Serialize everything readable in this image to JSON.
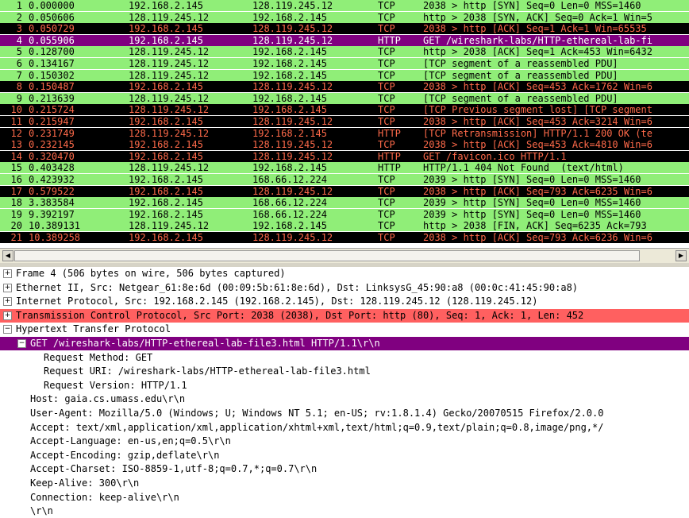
{
  "colors": {
    "tcp_ok_bg": "#90ee78",
    "tcp_bad_bg": "#000000",
    "tcp_bad_fg": "#ff6a4a",
    "selected_bg": "#800080",
    "selected_fg": "#ffffff",
    "tcp_tree_bg": "#ff6060",
    "http_tree_bg": "#800080"
  },
  "packets": [
    {
      "no": "1",
      "time": "0.000000",
      "src": "192.168.2.145",
      "dst": "128.119.245.12",
      "proto": "TCP",
      "info": "2038 > http [SYN] Seq=0 Len=0 MSS=1460",
      "style": "ok"
    },
    {
      "no": "2",
      "time": "0.050606",
      "src": "128.119.245.12",
      "dst": "192.168.2.145",
      "proto": "TCP",
      "info": "http > 2038 [SYN, ACK] Seq=0 Ack=1 Win=5",
      "style": "ok"
    },
    {
      "no": "3",
      "time": "0.050729",
      "src": "192.168.2.145",
      "dst": "128.119.245.12",
      "proto": "TCP",
      "info": "2038 > http [ACK] Seq=1 Ack=1 Win=65535",
      "style": "bad"
    },
    {
      "no": "4",
      "time": "0.055906",
      "src": "192.168.2.145",
      "dst": "128.119.245.12",
      "proto": "HTTP",
      "info": "GET /wireshark-labs/HTTP-ethereal-lab-fi",
      "style": "selected"
    },
    {
      "no": "5",
      "time": "0.128700",
      "src": "128.119.245.12",
      "dst": "192.168.2.145",
      "proto": "TCP",
      "info": "http > 2038 [ACK] Seq=1 Ack=453 Win=6432",
      "style": "ok"
    },
    {
      "no": "6",
      "time": "0.134167",
      "src": "128.119.245.12",
      "dst": "192.168.2.145",
      "proto": "TCP",
      "info": "[TCP segment of a reassembled PDU]",
      "style": "ok"
    },
    {
      "no": "7",
      "time": "0.150302",
      "src": "128.119.245.12",
      "dst": "192.168.2.145",
      "proto": "TCP",
      "info": "[TCP segment of a reassembled PDU]",
      "style": "ok"
    },
    {
      "no": "8",
      "time": "0.150487",
      "src": "192.168.2.145",
      "dst": "128.119.245.12",
      "proto": "TCP",
      "info": "2038 > http [ACK] Seq=453 Ack=1762 Win=6",
      "style": "bad"
    },
    {
      "no": "9",
      "time": "0.213639",
      "src": "128.119.245.12",
      "dst": "192.168.2.145",
      "proto": "TCP",
      "info": "[TCP segment of a reassembled PDU]",
      "style": "ok"
    },
    {
      "no": "10",
      "time": "0.215724",
      "src": "128.119.245.12",
      "dst": "192.168.2.145",
      "proto": "TCP",
      "info": "[TCP Previous segment lost] [TCP segment",
      "style": "bad"
    },
    {
      "no": "11",
      "time": "0.215947",
      "src": "192.168.2.145",
      "dst": "128.119.245.12",
      "proto": "TCP",
      "info": "2038 > http [ACK] Seq=453 Ack=3214 Win=6",
      "style": "bad"
    },
    {
      "no": "12",
      "time": "0.231749",
      "src": "128.119.245.12",
      "dst": "192.168.2.145",
      "proto": "HTTP",
      "info": "[TCP Retransmission] HTTP/1.1 200 OK (te",
      "style": "bad"
    },
    {
      "no": "13",
      "time": "0.232145",
      "src": "192.168.2.145",
      "dst": "128.119.245.12",
      "proto": "TCP",
      "info": "2038 > http [ACK] Seq=453 Ack=4810 Win=6",
      "style": "bad"
    },
    {
      "no": "14",
      "time": "0.320470",
      "src": "192.168.2.145",
      "dst": "128.119.245.12",
      "proto": "HTTP",
      "info": "GET /favicon.ico HTTP/1.1",
      "style": "bad"
    },
    {
      "no": "15",
      "time": "0.403428",
      "src": "128.119.245.12",
      "dst": "192.168.2.145",
      "proto": "HTTP",
      "info": "HTTP/1.1 404 Not Found  (text/html)",
      "style": "ok"
    },
    {
      "no": "16",
      "time": "0.423932",
      "src": "192.168.2.145",
      "dst": "168.66.12.224",
      "proto": "TCP",
      "info": "2039 > http [SYN] Seq=0 Len=0 MSS=1460",
      "style": "ok"
    },
    {
      "no": "17",
      "time": "0.579522",
      "src": "192.168.2.145",
      "dst": "128.119.245.12",
      "proto": "TCP",
      "info": "2038 > http [ACK] Seq=793 Ack=6235 Win=6",
      "style": "bad"
    },
    {
      "no": "18",
      "time": "3.383584",
      "src": "192.168.2.145",
      "dst": "168.66.12.224",
      "proto": "TCP",
      "info": "2039 > http [SYN] Seq=0 Len=0 MSS=1460",
      "style": "ok"
    },
    {
      "no": "19",
      "time": "9.392197",
      "src": "192.168.2.145",
      "dst": "168.66.12.224",
      "proto": "TCP",
      "info": "2039 > http [SYN] Seq=0 Len=0 MSS=1460",
      "style": "ok"
    },
    {
      "no": "20",
      "time": "10.389131",
      "src": "128.119.245.12",
      "dst": "192.168.2.145",
      "proto": "TCP",
      "info": "http > 2038 [FIN, ACK] Seq=6235 Ack=793 ",
      "style": "ok"
    },
    {
      "no": "21",
      "time": "10.389258",
      "src": "192.168.2.145",
      "dst": "128.119.245.12",
      "proto": "TCP",
      "info": "2038 > http [ACK] Seq=793 Ack=6236 Win=6",
      "style": "bad"
    }
  ],
  "scrollbar": {
    "left_arrow": "◀",
    "right_arrow": "▶"
  },
  "details": [
    {
      "toggle": "+",
      "indent": 0,
      "text": "Frame 4 (506 bytes on wire, 506 bytes captured)",
      "style": "normal"
    },
    {
      "toggle": "+",
      "indent": 0,
      "text": "Ethernet II, Src: Netgear_61:8e:6d (00:09:5b:61:8e:6d), Dst: LinksysG_45:90:a8 (00:0c:41:45:90:a8)",
      "style": "normal"
    },
    {
      "toggle": "+",
      "indent": 0,
      "text": "Internet Protocol, Src: 192.168.2.145 (192.168.2.145), Dst: 128.119.245.12 (128.119.245.12)",
      "style": "normal"
    },
    {
      "toggle": "+",
      "indent": 0,
      "text": "Transmission Control Protocol, Src Port: 2038 (2038), Dst Port: http (80), Seq: 1, Ack: 1, Len: 452",
      "style": "tcp"
    },
    {
      "toggle": "−",
      "indent": 0,
      "text": "Hypertext Transfer Protocol",
      "style": "normal"
    },
    {
      "toggle": "−",
      "indent": 1,
      "text": "GET /wireshark-labs/HTTP-ethereal-lab-file3.html HTTP/1.1\\r\\n",
      "style": "http"
    },
    {
      "toggle": "",
      "indent": 3,
      "text": "Request Method: GET",
      "style": "normal"
    },
    {
      "toggle": "",
      "indent": 3,
      "text": "Request URI: /wireshark-labs/HTTP-ethereal-lab-file3.html",
      "style": "normal"
    },
    {
      "toggle": "",
      "indent": 3,
      "text": "Request Version: HTTP/1.1",
      "style": "normal"
    },
    {
      "toggle": "",
      "indent": 2,
      "text": "Host: gaia.cs.umass.edu\\r\\n",
      "style": "normal"
    },
    {
      "toggle": "",
      "indent": 2,
      "text": "User-Agent: Mozilla/5.0 (Windows; U; Windows NT 5.1; en-US; rv:1.8.1.4) Gecko/20070515 Firefox/2.0.0",
      "style": "normal"
    },
    {
      "toggle": "",
      "indent": 2,
      "text": "Accept: text/xml,application/xml,application/xhtml+xml,text/html;q=0.9,text/plain;q=0.8,image/png,*/",
      "style": "normal"
    },
    {
      "toggle": "",
      "indent": 2,
      "text": "Accept-Language: en-us,en;q=0.5\\r\\n",
      "style": "normal"
    },
    {
      "toggle": "",
      "indent": 2,
      "text": "Accept-Encoding: gzip,deflate\\r\\n",
      "style": "normal"
    },
    {
      "toggle": "",
      "indent": 2,
      "text": "Accept-Charset: ISO-8859-1,utf-8;q=0.7,*;q=0.7\\r\\n",
      "style": "normal"
    },
    {
      "toggle": "",
      "indent": 2,
      "text": "Keep-Alive: 300\\r\\n",
      "style": "normal"
    },
    {
      "toggle": "",
      "indent": 2,
      "text": "Connection: keep-alive\\r\\n",
      "style": "normal"
    },
    {
      "toggle": "",
      "indent": 2,
      "text": "\\r\\n",
      "style": "normal"
    }
  ]
}
